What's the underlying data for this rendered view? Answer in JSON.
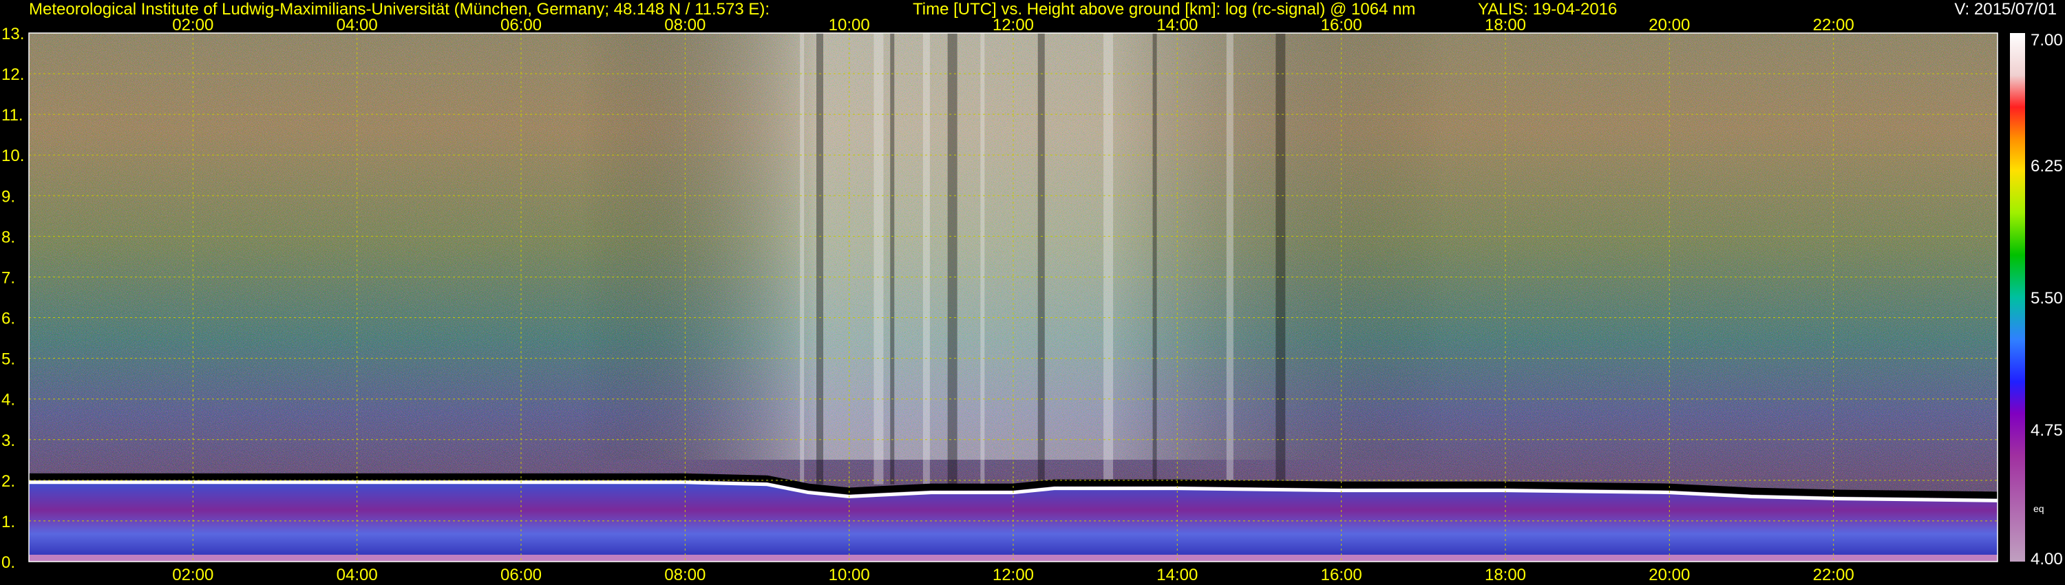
{
  "header": {
    "institute": "Meteorological Institute of Ludwig-Maximilians-Universität (München, Germany; 48.148 N / 11.573 E):",
    "title": "Time [UTC] vs. Height above ground [km]: log (rc-signal) @ 1064 nm",
    "system": "YALIS: 19-04-2016",
    "version": "V: 2015/07/01"
  },
  "chart_data": {
    "type": "heatmap",
    "title": "Time [UTC] vs. Height above ground [km]: log (rc-signal) @ 1064 nm",
    "x_ticks": [
      "02:00",
      "04:00",
      "06:00",
      "08:00",
      "10:00",
      "12:00",
      "14:00",
      "16:00",
      "18:00",
      "20:00",
      "22:00"
    ],
    "x_tick_hours": [
      2,
      4,
      6,
      8,
      10,
      12,
      14,
      16,
      18,
      20,
      22
    ],
    "xlim_hours": [
      0,
      24
    ],
    "y_ticks": [
      "0.",
      "1.",
      "2.",
      "3.",
      "4.",
      "5.",
      "6.",
      "7.",
      "8.",
      "9.",
      "10.",
      "11.",
      "12.",
      "13."
    ],
    "y_tick_values": [
      0,
      1,
      2,
      3,
      4,
      5,
      6,
      7,
      8,
      9,
      10,
      11,
      12,
      13
    ],
    "ylim": [
      0,
      13
    ],
    "grid": true,
    "colorbar": {
      "ticks": [
        "7.00",
        "6.25",
        "5.50",
        "4.75",
        "4.00"
      ],
      "tick_values": [
        7.0,
        6.25,
        5.5,
        4.75,
        4.0
      ],
      "range": [
        4.0,
        7.0
      ],
      "unit_label": "eq"
    },
    "boundary_layer_top_km": [
      [
        0.0,
        1.95
      ],
      [
        2.0,
        1.95
      ],
      [
        4.0,
        1.95
      ],
      [
        6.0,
        1.95
      ],
      [
        8.0,
        1.95
      ],
      [
        9.0,
        1.9
      ],
      [
        9.5,
        1.7
      ],
      [
        10.0,
        1.6
      ],
      [
        11.0,
        1.7
      ],
      [
        12.0,
        1.7
      ],
      [
        12.5,
        1.8
      ],
      [
        14.0,
        1.8
      ],
      [
        16.0,
        1.75
      ],
      [
        18.0,
        1.75
      ],
      [
        20.0,
        1.7
      ],
      [
        21.0,
        1.6
      ],
      [
        22.0,
        1.55
      ],
      [
        24.0,
        1.5
      ]
    ],
    "colors": {
      "background": "#000000",
      "text": "#ffff00",
      "grid": "#c8c800"
    }
  }
}
